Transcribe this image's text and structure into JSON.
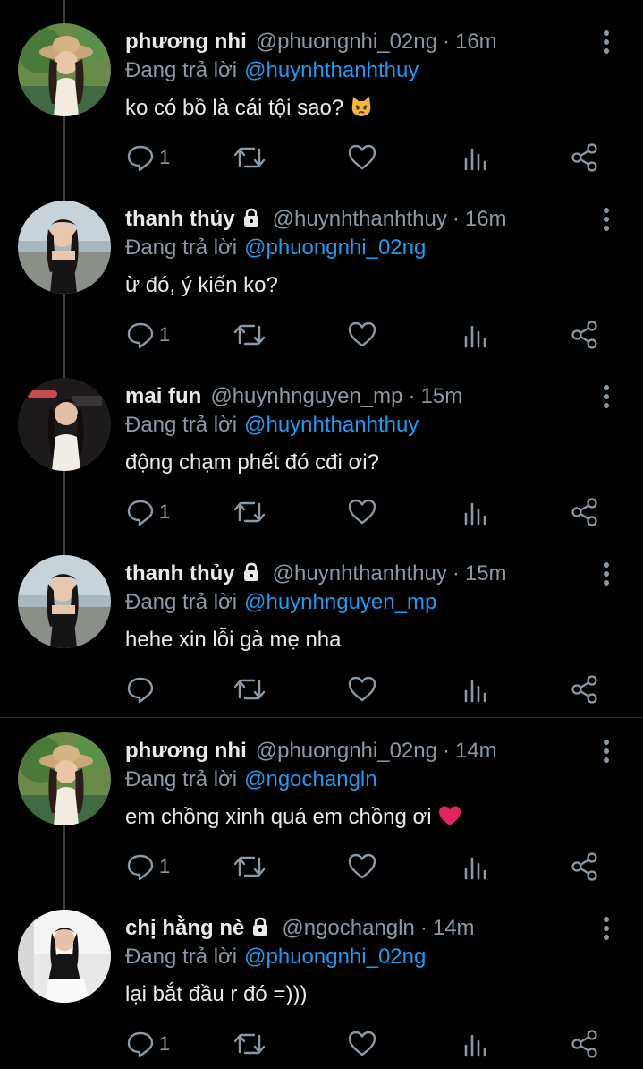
{
  "colors": {
    "background": "#000000",
    "name": "#e7e9ea",
    "muted": "#8b98a5",
    "mention": "#1d9bf0",
    "heart_emoji": "#e0245e"
  },
  "icons": {
    "reply": "reply-icon",
    "retweet": "retweet-icon",
    "like": "heart-icon",
    "stats": "stats-icon",
    "share": "share-icon",
    "more": "more-vertical-icon",
    "lock": "lock-icon"
  },
  "reply_prefix": "Đang trả lời",
  "tweets": [
    {
      "name": "phương nhi",
      "handle": "@phuongnhi_02ng",
      "time": "16m",
      "locked": false,
      "reply_to": "@huynhthanhthuy",
      "text": "ko có bồ là cái tội sao?",
      "emoji": "pouting-cat-emoji",
      "reply_count": "1"
    },
    {
      "name": "thanh thủy",
      "handle": "@huynhthanhthuy",
      "time": "16m",
      "locked": true,
      "reply_to": "@phuongnhi_02ng",
      "text": "ừ đó, ý kiến ko?",
      "emoji": "",
      "reply_count": "1"
    },
    {
      "name": "mai fun",
      "handle": "@huynhnguyen_mp",
      "time": "15m",
      "locked": false,
      "reply_to": "@huynhthanhthuy",
      "text": "động chạm phết đó cđi ơi?",
      "emoji": "",
      "reply_count": "1"
    },
    {
      "name": "thanh thủy",
      "handle": "@huynhthanhthuy",
      "time": "15m",
      "locked": true,
      "reply_to": "@huynhnguyen_mp",
      "text": "hehe xin lỗi gà mẹ nha",
      "emoji": "",
      "reply_count": ""
    },
    {
      "name": "phương nhi",
      "handle": "@phuongnhi_02ng",
      "time": "14m",
      "locked": false,
      "reply_to": "@ngochangln",
      "text": "em chồng xinh quá em chồng ơi",
      "emoji": "red-heart-emoji",
      "reply_count": "1"
    },
    {
      "name": "chị hằng nè",
      "handle": "@ngochangln",
      "time": "14m",
      "locked": true,
      "reply_to": "@phuongnhi_02ng",
      "text": "lại bắt đầu r đó =)))",
      "emoji": "",
      "reply_count": "1"
    }
  ]
}
